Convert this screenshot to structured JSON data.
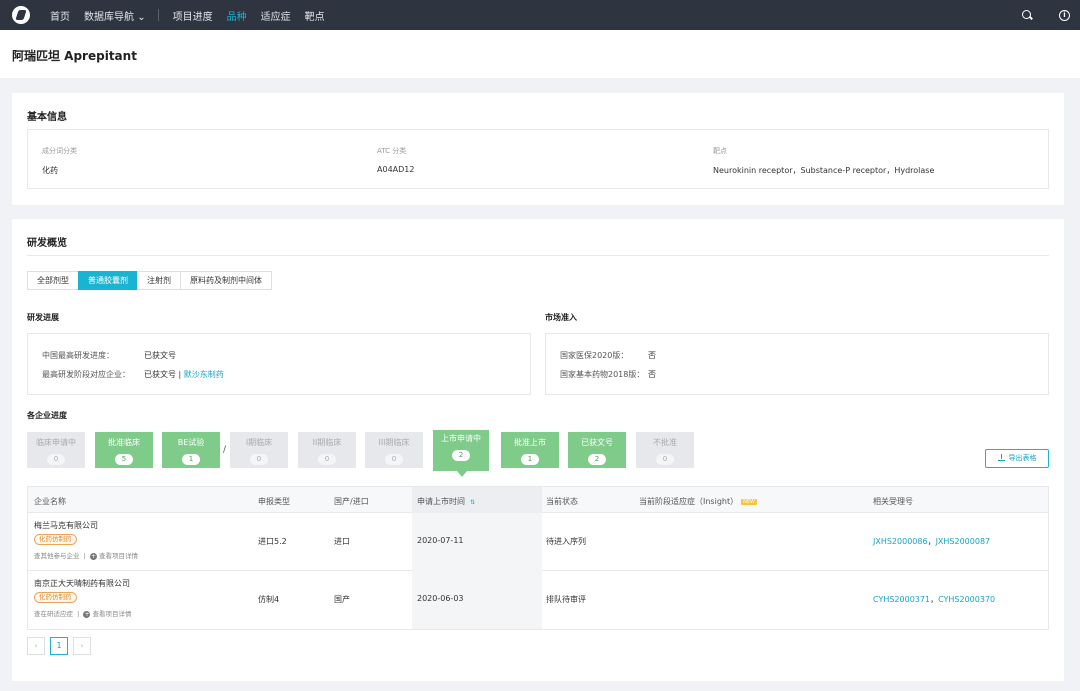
{
  "nav": {
    "items": [
      "首页",
      "数据库导航",
      "项目进度",
      "品种",
      "适应症",
      "靶点"
    ],
    "dropdown_arrow": "⌄",
    "icons": [
      "search-icon",
      "info-icon"
    ]
  },
  "page_title": "阿瑞匹坦 Aprepitant",
  "basic": {
    "heading": "基本信息",
    "fields": [
      {
        "label": "成分词分类",
        "value": "化药"
      },
      {
        "label": "ATC 分类",
        "value": "A04AD12"
      },
      {
        "label": "靶点",
        "value": "Neurokinin receptor，Substance-P receptor，Hydrolase"
      }
    ]
  },
  "rd": {
    "heading": "研发概览",
    "tabs": [
      "全部剂型",
      "普通胶囊剂",
      "注射剂",
      "原料药及制剂中间体"
    ],
    "active_tab": 1,
    "progress": {
      "heading": "研发进展",
      "row1_key": "中国最高研发进度：",
      "row1_val": "已获文号",
      "row2_key": "最高研发阶段对应企业：",
      "row2_val": "已获文号 |",
      "row2_link": "默沙东制药"
    },
    "market": {
      "heading": "市场准入",
      "row1_key": "国家医保2020版：",
      "row1_val": "否",
      "row2_key": "国家基本药物2018版：",
      "row2_val": "否"
    },
    "stages_heading": "各企业进度",
    "stages": [
      {
        "name": "临床申请中",
        "count": "0",
        "state": "grey"
      },
      {
        "name": "批准临床",
        "count": "5",
        "state": "green"
      },
      {
        "name": "BE试验",
        "count": "1",
        "state": "green"
      },
      {
        "name": "I期临床",
        "count": "0",
        "state": "grey"
      },
      {
        "name": "II期临床",
        "count": "0",
        "state": "grey"
      },
      {
        "name": "III期临床",
        "count": "0",
        "state": "grey"
      },
      {
        "name": "上市申请中",
        "count": "2",
        "state": "green"
      },
      {
        "name": "批准上市",
        "count": "1",
        "state": "green"
      },
      {
        "name": "已获文号",
        "count": "2",
        "state": "green"
      },
      {
        "name": "不批准",
        "count": "0",
        "state": "grey"
      }
    ],
    "flow_sep": "/",
    "export_label": "导出表格",
    "table": {
      "headers": [
        "企业名称",
        "申报类型",
        "国产/进口",
        "申请上市时间",
        "当前状态",
        "当前阶段适应症（Insight）",
        "相关受理号"
      ],
      "new_badge": "NEW",
      "sort_icon": "⇅",
      "rows": [
        {
          "company": "梅兰马克有限公司",
          "tag": "化药仿制药",
          "action1": "查其他参与企业",
          "action2": "查看项目详情",
          "type": "进口5.2",
          "origin": "进口",
          "date": "2020-07-11",
          "status": "待进入序列",
          "indication": "",
          "no1": "JXHS2000086",
          "no2": "JXHS2000087"
        },
        {
          "company": "南京正大天晴制药有限公司",
          "tag": "化药仿制药",
          "action1": "查在研适应症",
          "action2": "查看项目详情",
          "type": "仿制4",
          "origin": "国产",
          "date": "2020-06-03",
          "status": "排队待审评",
          "indication": "",
          "no1": "CYHS2000371",
          "no2": "CYHS2000370"
        }
      ],
      "sep": "，"
    },
    "pager": {
      "prev": "‹",
      "page": "1",
      "next": "›"
    }
  },
  "colors": {
    "accent": "#19b4d2",
    "green": "#7fcb8a",
    "nav_bg": "#2e3440"
  }
}
